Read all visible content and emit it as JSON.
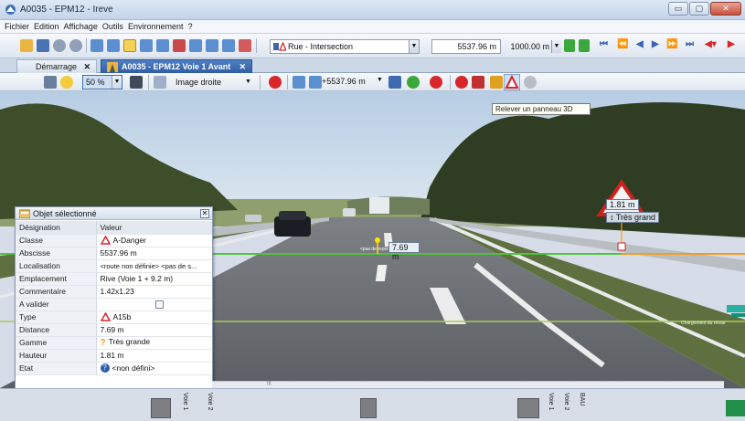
{
  "window": {
    "title": "A0035 - EPM12 - Ireve",
    "minimize": "▭",
    "maximize": "▢",
    "close": "✕"
  },
  "menu": [
    "Fichier",
    "Edition",
    "Affichage",
    "Outils",
    "Environnement",
    "?"
  ],
  "toolbar": {
    "sign_filter": "Rue - Intersection",
    "abscissa": "5537.96 m",
    "step": "1000.00 m"
  },
  "tabs": [
    {
      "label": "Démarrage",
      "close": "✕"
    },
    {
      "label": "A0035 - EPM12 Voie 1 Avant",
      "close": "✕"
    }
  ],
  "toolbar2": {
    "zoom": "50 %",
    "view": "Image droite",
    "measure": "+5537.96 m"
  },
  "tooltip": "Relever un panneau 3D",
  "overlay": {
    "distance_label": "7.69 m",
    "height_label": "1.81 m",
    "range_label": "Très grand",
    "road_text": "<pas de repère>",
    "right_text": "Chargement du retour"
  },
  "panel": {
    "title": "Objet sélectionné",
    "close": "✕",
    "col_name": "Désignation",
    "col_value": "Valeur",
    "rows": [
      {
        "key": "Classe",
        "value": "A-Danger",
        "icon": "warning-triangle-icon"
      },
      {
        "key": "Abscisse",
        "value": "5537.96 m"
      },
      {
        "key": "Localisation",
        "value": "<route non définie> <pas de s..."
      },
      {
        "key": "Emplacement",
        "value": "Rive (Voie 1 + 9.2 m)"
      },
      {
        "key": "Commentaire",
        "value": "1.42x1.23"
      },
      {
        "key": "A valider",
        "value": ""
      },
      {
        "key": "Type",
        "value": "A15b",
        "icon": "warning-triangle-icon"
      },
      {
        "key": "Distance",
        "value": "7.69 m"
      },
      {
        "key": "Gamme",
        "value": "Très grande",
        "icon": "question-icon"
      },
      {
        "key": "Hauteur",
        "value": "1.81 m"
      },
      {
        "key": "Etat",
        "value": "<non défini>",
        "icon": "help-circle-icon"
      }
    ]
  },
  "bottom": {
    "labels": [
      "Voie 1",
      "Voie 2",
      "Voie 1",
      "Voie 2",
      "BAU"
    ],
    "scroll_marker": "|||"
  },
  "colors": {
    "accent": "#2f5ea6",
    "green_line": "#4fc43a",
    "orange": "#f0a020",
    "danger": "#d8262a"
  }
}
